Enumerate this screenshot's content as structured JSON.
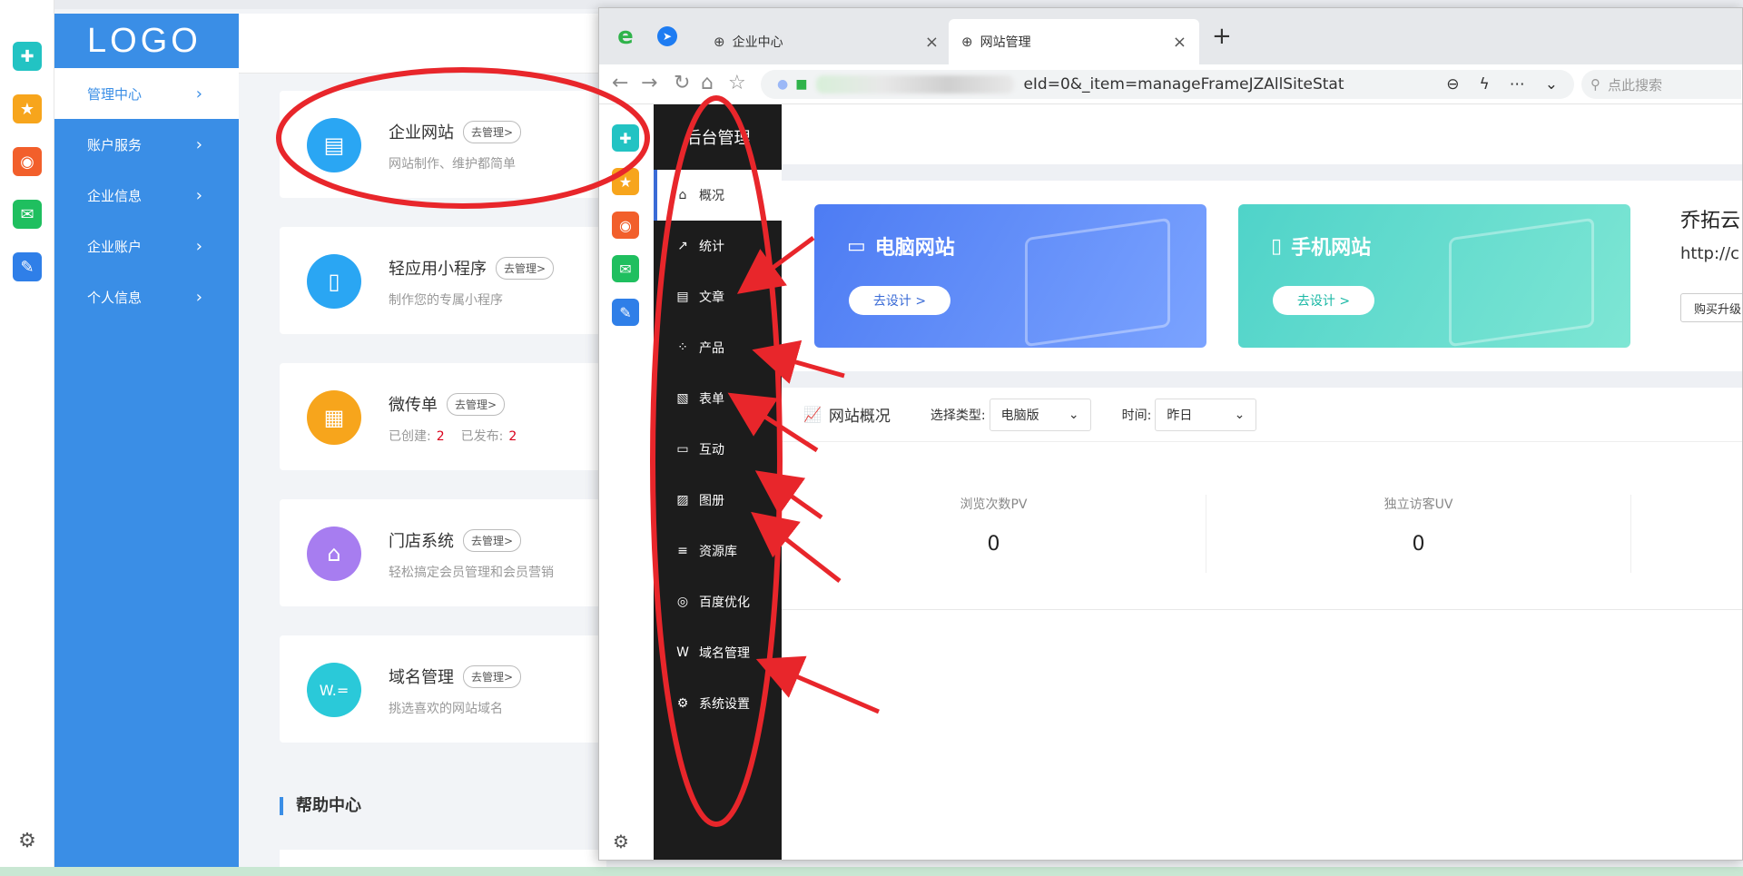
{
  "bg": {
    "logo": "LOGO",
    "nav": [
      {
        "label": "管理中心",
        "active": true
      },
      {
        "label": "账户服务"
      },
      {
        "label": "企业信息"
      },
      {
        "label": "企业账户"
      },
      {
        "label": "个人信息"
      }
    ],
    "manage_label": "去管理>",
    "cards": [
      {
        "title": "企业网站",
        "desc": "网站制作、维护都简单",
        "color": "#2aa6f3",
        "icon": "website-icon"
      },
      {
        "title": "轻应用小程序",
        "desc": "制作您的专属小程序",
        "color": "#2aa6f3",
        "icon": "miniapp-icon"
      },
      {
        "title": "微传单",
        "desc_created": "已创建:",
        "created": "2",
        "desc_published": "已发布:",
        "published": "2",
        "color": "#f7a51c",
        "icon": "flyer-icon"
      },
      {
        "title": "门店系统",
        "desc": "轻松搞定会员管理和会员营销",
        "color": "#a77df0",
        "icon": "store-icon"
      },
      {
        "title": "域名管理",
        "desc": "挑选喜欢的网站域名",
        "color": "#2ac9d9",
        "icon": "domain-icon"
      }
    ],
    "help_title": "帮助中心"
  },
  "browser": {
    "tabs": [
      {
        "label": "企业中心"
      },
      {
        "label": "网站管理",
        "active": true
      }
    ],
    "url": "eId=0&_item=manageFrameJZAllSiteStat",
    "search_placeholder": "点此搜索"
  },
  "admin": {
    "title": "后台管理",
    "menu": [
      {
        "label": "概况",
        "icon": "home-icon",
        "active": true
      },
      {
        "label": "统计",
        "icon": "stats-icon"
      },
      {
        "label": "文章",
        "icon": "article-icon"
      },
      {
        "label": "产品",
        "icon": "product-icon"
      },
      {
        "label": "表单",
        "icon": "form-icon"
      },
      {
        "label": "互动",
        "icon": "chat-icon"
      },
      {
        "label": "图册",
        "icon": "album-icon"
      },
      {
        "label": "资源库",
        "icon": "database-icon"
      },
      {
        "label": "百度优化",
        "icon": "seo-icon"
      },
      {
        "label": "域名管理",
        "icon": "domain-icon"
      },
      {
        "label": "系统设置",
        "icon": "gear-icon"
      }
    ],
    "banners": [
      {
        "title": "电脑网站",
        "button": "去设计 >"
      },
      {
        "title": "手机网站",
        "button": "去设计 >"
      }
    ],
    "site_name": "乔拓云",
    "site_url": "http://c",
    "buy_label": "购买升级",
    "overview": {
      "title": "网站概况",
      "type_label": "选择类型:",
      "type_value": "电脑版",
      "time_label": "时间:",
      "time_value": "昨日",
      "stats": [
        {
          "label": "浏览次数PV",
          "value": "0"
        },
        {
          "label": "独立访客UV",
          "value": "0"
        }
      ]
    }
  },
  "colors": {
    "primary_blue": "#3a8ee6",
    "annotation_red": "#e8262b",
    "dark_sidebar": "#1c1c1c"
  }
}
